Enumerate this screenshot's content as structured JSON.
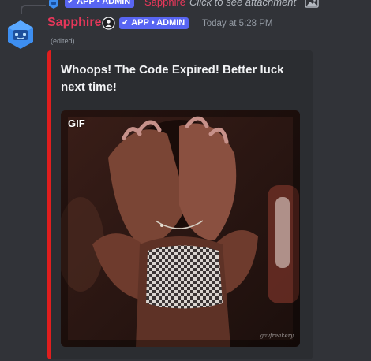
{
  "reply": {
    "badge": "APP • ADMIN",
    "author": "Sapphire",
    "text": "Click to see attachment"
  },
  "message": {
    "author": "Sapphire",
    "badge": "APP • ADMIN",
    "timestamp": "Today at 5:28 PM",
    "edited": "(edited)"
  },
  "embed": {
    "accent_color": "#e01e1e",
    "title": "Whoops! The Code Expired! Better luck next time!",
    "gif_label": "GIF",
    "watermark": "gavfreakery"
  },
  "colors": {
    "username": "#e8375a",
    "badge": "#5865f2",
    "background": "#313338"
  },
  "icons": {
    "avatar": "sapphire-robot-avatar",
    "role": "role-icon",
    "badge": "checkmark-icon",
    "attachment": "image-icon"
  }
}
